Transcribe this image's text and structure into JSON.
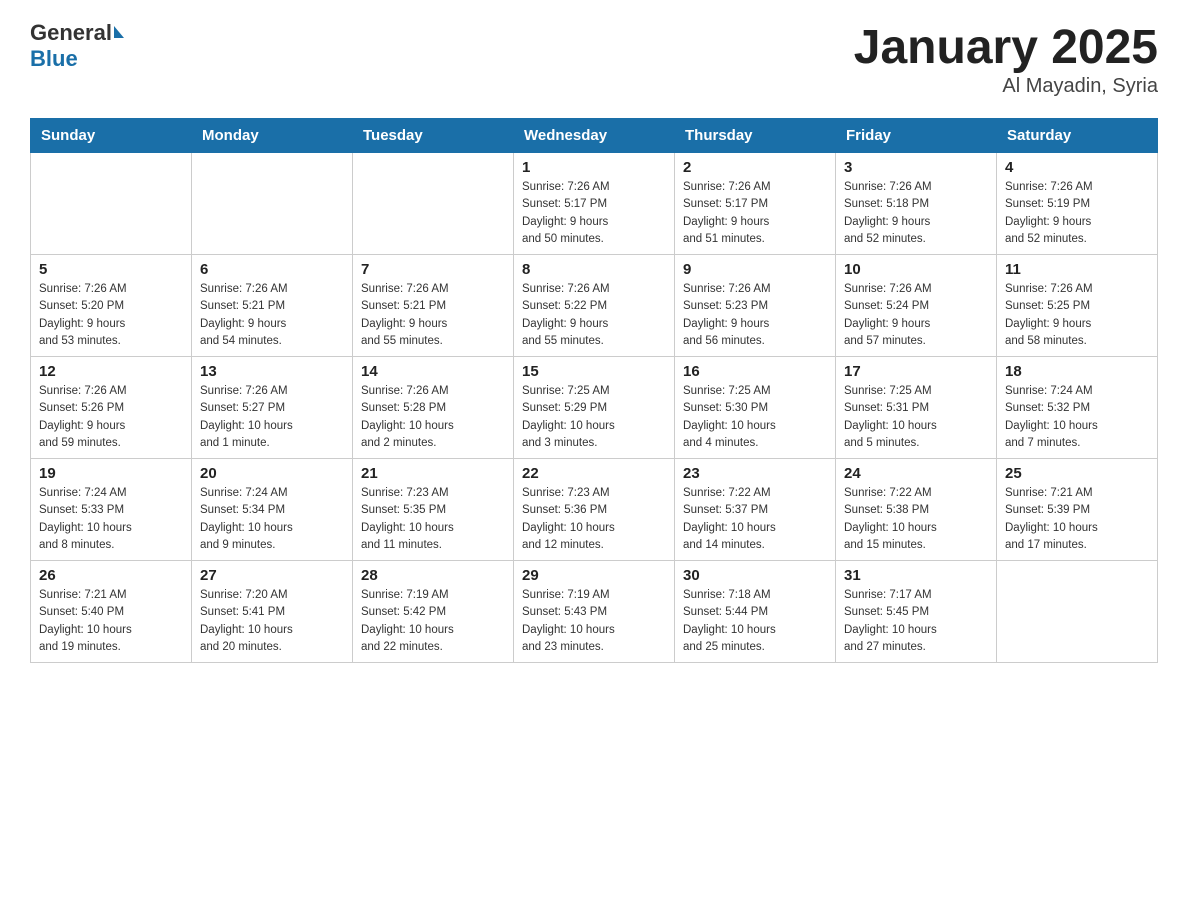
{
  "header": {
    "logo_general": "General",
    "logo_blue": "Blue",
    "month_year": "January 2025",
    "location": "Al Mayadin, Syria"
  },
  "weekdays": [
    "Sunday",
    "Monday",
    "Tuesday",
    "Wednesday",
    "Thursday",
    "Friday",
    "Saturday"
  ],
  "weeks": [
    [
      {
        "day": "",
        "info": ""
      },
      {
        "day": "",
        "info": ""
      },
      {
        "day": "",
        "info": ""
      },
      {
        "day": "1",
        "info": "Sunrise: 7:26 AM\nSunset: 5:17 PM\nDaylight: 9 hours\nand 50 minutes."
      },
      {
        "day": "2",
        "info": "Sunrise: 7:26 AM\nSunset: 5:17 PM\nDaylight: 9 hours\nand 51 minutes."
      },
      {
        "day": "3",
        "info": "Sunrise: 7:26 AM\nSunset: 5:18 PM\nDaylight: 9 hours\nand 52 minutes."
      },
      {
        "day": "4",
        "info": "Sunrise: 7:26 AM\nSunset: 5:19 PM\nDaylight: 9 hours\nand 52 minutes."
      }
    ],
    [
      {
        "day": "5",
        "info": "Sunrise: 7:26 AM\nSunset: 5:20 PM\nDaylight: 9 hours\nand 53 minutes."
      },
      {
        "day": "6",
        "info": "Sunrise: 7:26 AM\nSunset: 5:21 PM\nDaylight: 9 hours\nand 54 minutes."
      },
      {
        "day": "7",
        "info": "Sunrise: 7:26 AM\nSunset: 5:21 PM\nDaylight: 9 hours\nand 55 minutes."
      },
      {
        "day": "8",
        "info": "Sunrise: 7:26 AM\nSunset: 5:22 PM\nDaylight: 9 hours\nand 55 minutes."
      },
      {
        "day": "9",
        "info": "Sunrise: 7:26 AM\nSunset: 5:23 PM\nDaylight: 9 hours\nand 56 minutes."
      },
      {
        "day": "10",
        "info": "Sunrise: 7:26 AM\nSunset: 5:24 PM\nDaylight: 9 hours\nand 57 minutes."
      },
      {
        "day": "11",
        "info": "Sunrise: 7:26 AM\nSunset: 5:25 PM\nDaylight: 9 hours\nand 58 minutes."
      }
    ],
    [
      {
        "day": "12",
        "info": "Sunrise: 7:26 AM\nSunset: 5:26 PM\nDaylight: 9 hours\nand 59 minutes."
      },
      {
        "day": "13",
        "info": "Sunrise: 7:26 AM\nSunset: 5:27 PM\nDaylight: 10 hours\nand 1 minute."
      },
      {
        "day": "14",
        "info": "Sunrise: 7:26 AM\nSunset: 5:28 PM\nDaylight: 10 hours\nand 2 minutes."
      },
      {
        "day": "15",
        "info": "Sunrise: 7:25 AM\nSunset: 5:29 PM\nDaylight: 10 hours\nand 3 minutes."
      },
      {
        "day": "16",
        "info": "Sunrise: 7:25 AM\nSunset: 5:30 PM\nDaylight: 10 hours\nand 4 minutes."
      },
      {
        "day": "17",
        "info": "Sunrise: 7:25 AM\nSunset: 5:31 PM\nDaylight: 10 hours\nand 5 minutes."
      },
      {
        "day": "18",
        "info": "Sunrise: 7:24 AM\nSunset: 5:32 PM\nDaylight: 10 hours\nand 7 minutes."
      }
    ],
    [
      {
        "day": "19",
        "info": "Sunrise: 7:24 AM\nSunset: 5:33 PM\nDaylight: 10 hours\nand 8 minutes."
      },
      {
        "day": "20",
        "info": "Sunrise: 7:24 AM\nSunset: 5:34 PM\nDaylight: 10 hours\nand 9 minutes."
      },
      {
        "day": "21",
        "info": "Sunrise: 7:23 AM\nSunset: 5:35 PM\nDaylight: 10 hours\nand 11 minutes."
      },
      {
        "day": "22",
        "info": "Sunrise: 7:23 AM\nSunset: 5:36 PM\nDaylight: 10 hours\nand 12 minutes."
      },
      {
        "day": "23",
        "info": "Sunrise: 7:22 AM\nSunset: 5:37 PM\nDaylight: 10 hours\nand 14 minutes."
      },
      {
        "day": "24",
        "info": "Sunrise: 7:22 AM\nSunset: 5:38 PM\nDaylight: 10 hours\nand 15 minutes."
      },
      {
        "day": "25",
        "info": "Sunrise: 7:21 AM\nSunset: 5:39 PM\nDaylight: 10 hours\nand 17 minutes."
      }
    ],
    [
      {
        "day": "26",
        "info": "Sunrise: 7:21 AM\nSunset: 5:40 PM\nDaylight: 10 hours\nand 19 minutes."
      },
      {
        "day": "27",
        "info": "Sunrise: 7:20 AM\nSunset: 5:41 PM\nDaylight: 10 hours\nand 20 minutes."
      },
      {
        "day": "28",
        "info": "Sunrise: 7:19 AM\nSunset: 5:42 PM\nDaylight: 10 hours\nand 22 minutes."
      },
      {
        "day": "29",
        "info": "Sunrise: 7:19 AM\nSunset: 5:43 PM\nDaylight: 10 hours\nand 23 minutes."
      },
      {
        "day": "30",
        "info": "Sunrise: 7:18 AM\nSunset: 5:44 PM\nDaylight: 10 hours\nand 25 minutes."
      },
      {
        "day": "31",
        "info": "Sunrise: 7:17 AM\nSunset: 5:45 PM\nDaylight: 10 hours\nand 27 minutes."
      },
      {
        "day": "",
        "info": ""
      }
    ]
  ]
}
